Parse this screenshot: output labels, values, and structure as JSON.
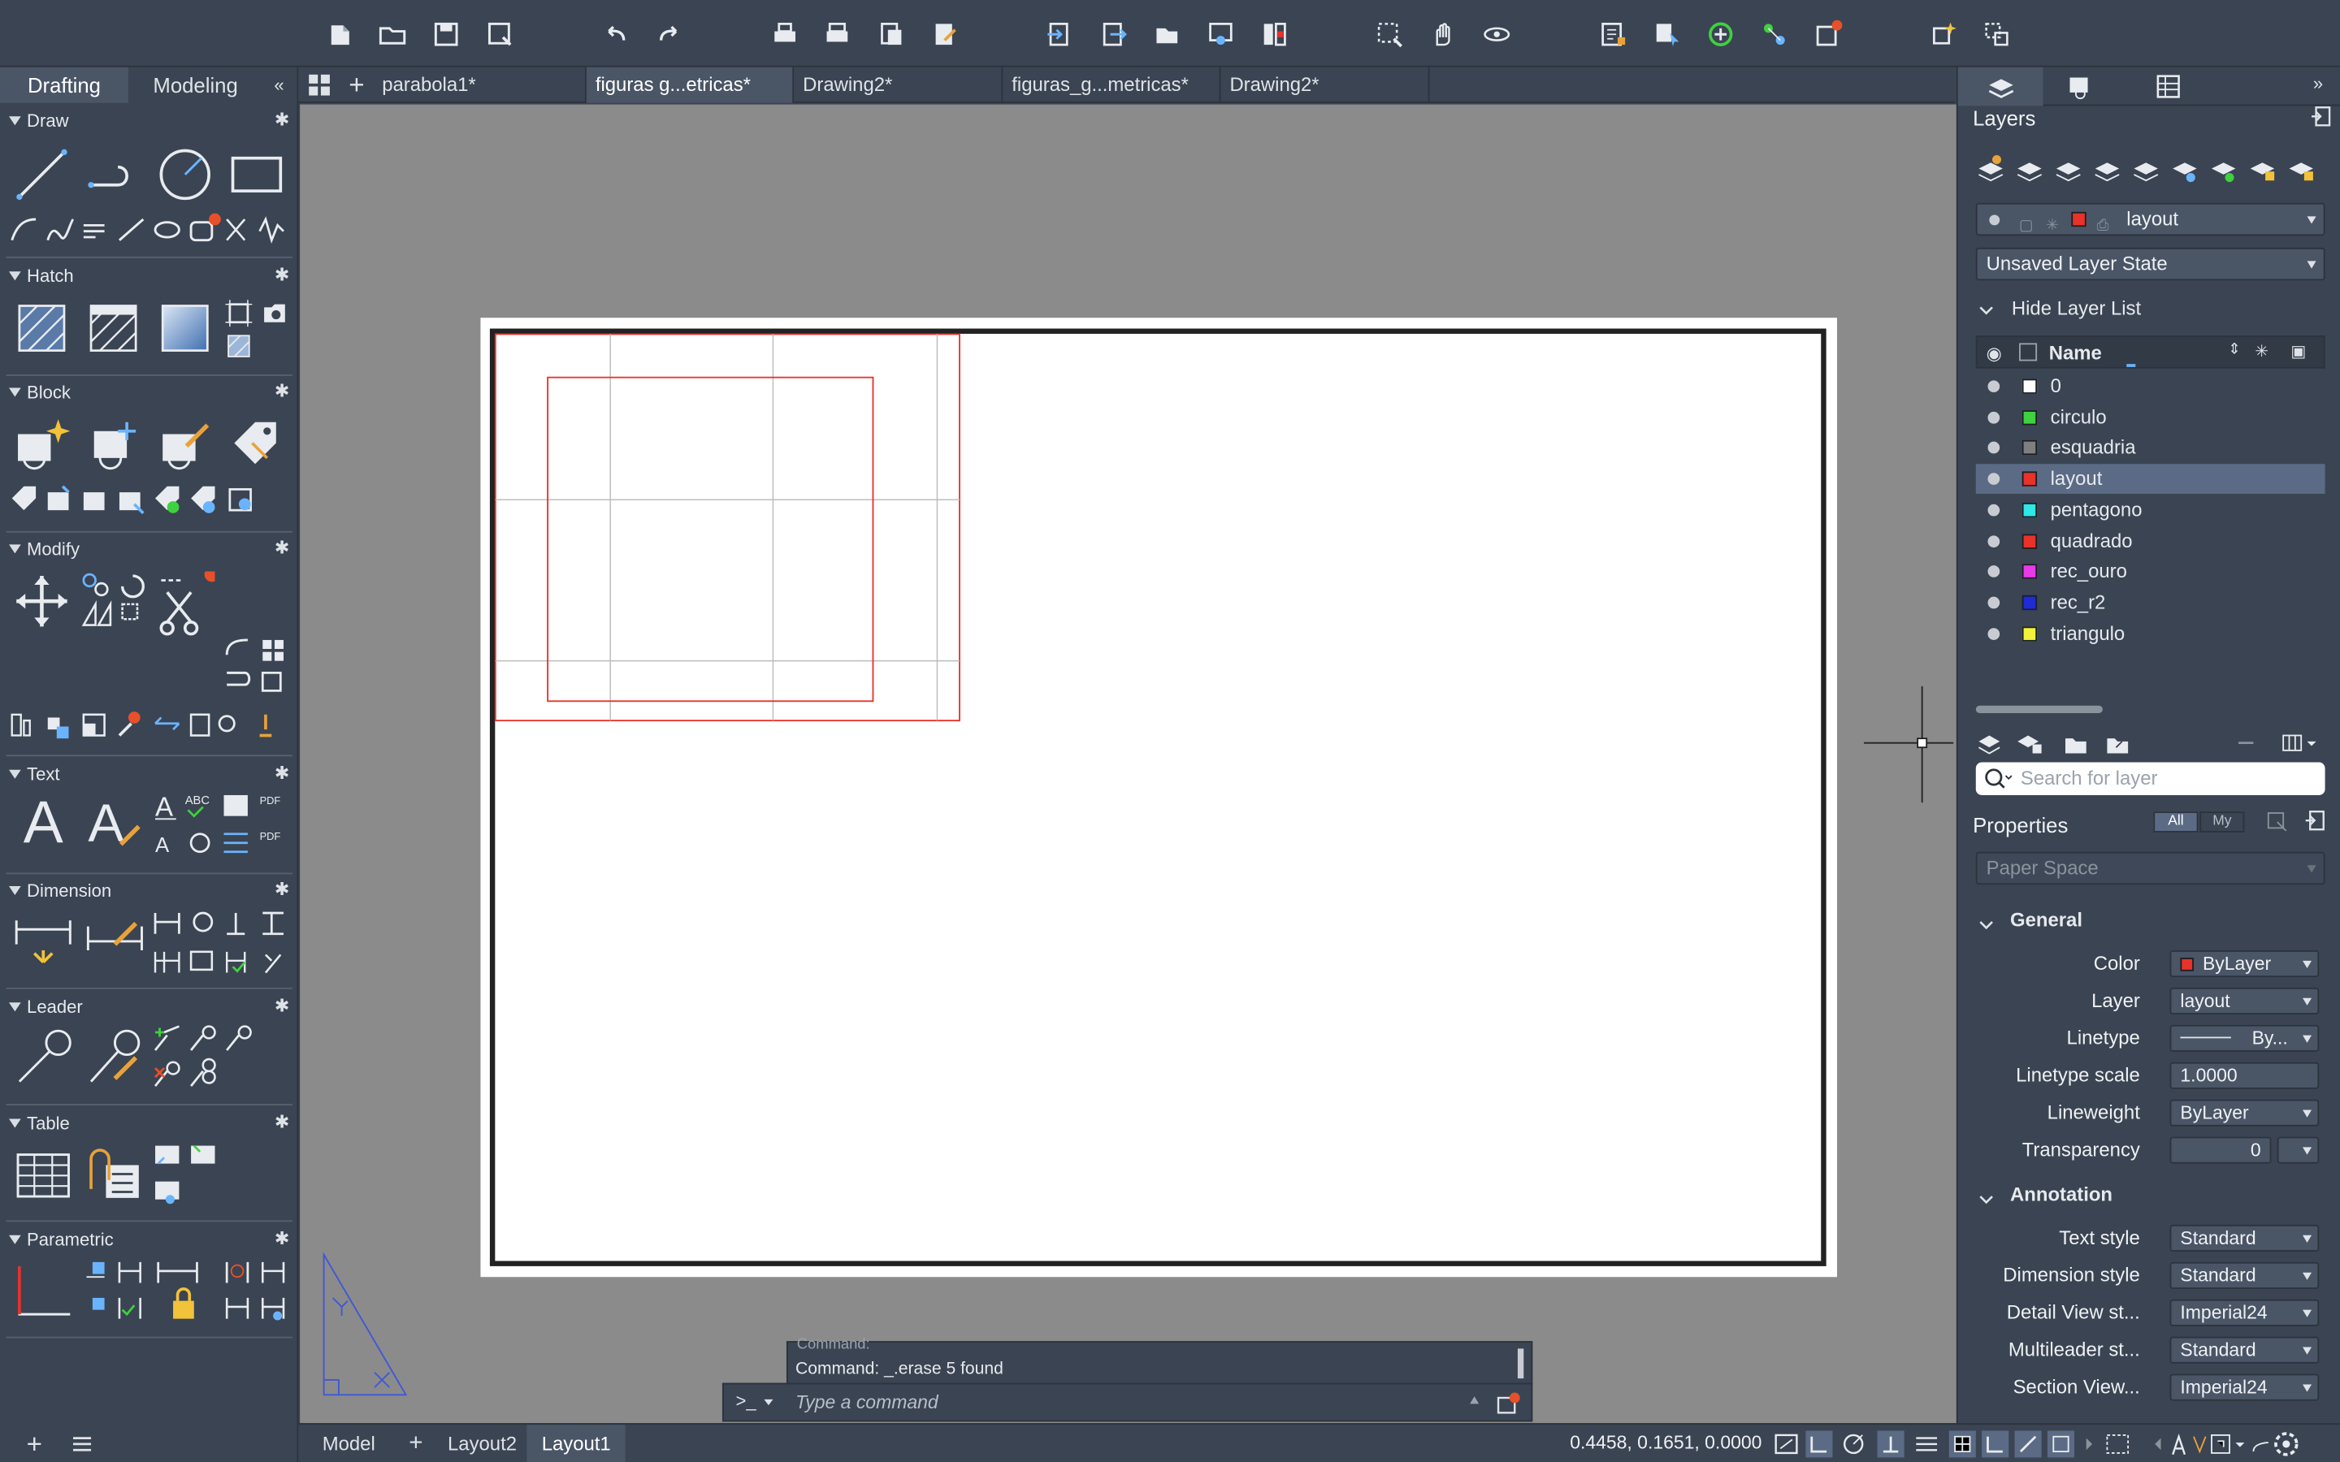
{
  "palette_tabs": {
    "drafting": "Drafting",
    "modeling": "Modeling"
  },
  "sections": {
    "draw": "Draw",
    "hatch": "Hatch",
    "block": "Block",
    "modify": "Modify",
    "text": "Text",
    "dimension": "Dimension",
    "leader": "Leader",
    "table": "Table",
    "parametric": "Parametric"
  },
  "doc_tabs": [
    "parabola1*",
    "figuras g...etricas*",
    "Drawing2*",
    "figuras_g...metricas*",
    "Drawing2*"
  ],
  "layers_panel": {
    "title": "Layers",
    "current_layer": "layout",
    "layer_state": "Unsaved Layer State",
    "hide_list": "Hide Layer List",
    "col_name": "Name",
    "search_placeholder": "Search for layer",
    "layers": [
      {
        "name": "0",
        "color": "#ffffff"
      },
      {
        "name": "circulo",
        "color": "#3fd13f"
      },
      {
        "name": "esquadria",
        "color": "#7f7f7f"
      },
      {
        "name": "layout",
        "color": "#e8322a"
      },
      {
        "name": "pentagono",
        "color": "#2ee8e8"
      },
      {
        "name": "quadrado",
        "color": "#e8322a"
      },
      {
        "name": "rec_ouro",
        "color": "#e83ae8"
      },
      {
        "name": "rec_r2",
        "color": "#1f2bd8"
      },
      {
        "name": "triangulo",
        "color": "#f2f23a"
      }
    ],
    "selected_layer": "layout"
  },
  "properties_panel": {
    "title": "Properties",
    "filter_all": "All",
    "filter_my": "My",
    "context": "Paper Space",
    "general": "General",
    "annotation": "Annotation",
    "general_rows": [
      {
        "label": "Color",
        "value": "ByLayer"
      },
      {
        "label": "Layer",
        "value": "layout"
      },
      {
        "label": "Linetype",
        "value": "By..."
      },
      {
        "label": "Linetype scale",
        "value": "1.0000"
      },
      {
        "label": "Lineweight",
        "value": "ByLayer"
      },
      {
        "label": "Transparency",
        "value": "0"
      }
    ],
    "annotation_rows": [
      {
        "label": "Text style",
        "value": "Standard"
      },
      {
        "label": "Dimension style",
        "value": "Standard"
      },
      {
        "label": "Detail View st...",
        "value": "Imperial24"
      },
      {
        "label": "Multileader st...",
        "value": "Standard"
      },
      {
        "label": "Section View...",
        "value": "Imperial24"
      }
    ]
  },
  "command": {
    "history_partial": "Command:",
    "last": "Command: _.erase 5 found",
    "prompt": ">_",
    "placeholder": "Type a command"
  },
  "bottom_tabs": {
    "model": "Model",
    "layout2": "Layout2",
    "layout1": "Layout1"
  },
  "status": {
    "coordinates": "0.4458, 0.1651, 0.0000"
  },
  "colors": {
    "accent_red": "#e8322a",
    "panel_bg": "#3b4452",
    "canvas_bg": "#8b8b8b",
    "selected_row": "#5b6b85"
  }
}
